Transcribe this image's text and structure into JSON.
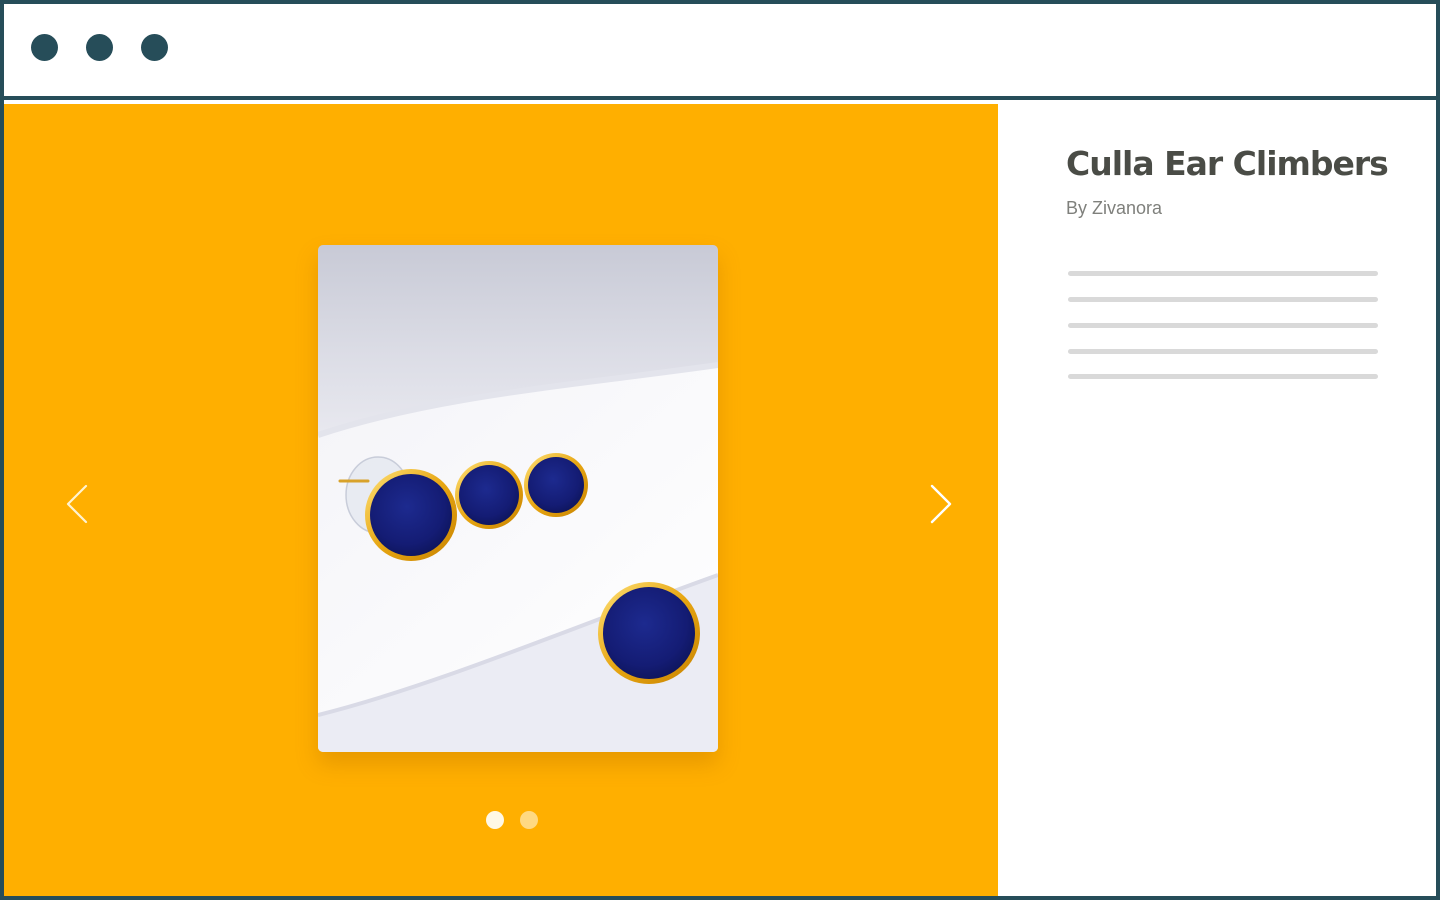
{
  "window": {
    "controls": [
      "window-dot",
      "window-dot",
      "window-dot"
    ],
    "frame_color": "#264d59"
  },
  "gallery": {
    "background_color": "#ffaf00",
    "prev_icon": "chevron-left-icon",
    "next_icon": "chevron-right-icon",
    "image_alt": "Navy enamel round earrings with gold rims on white fabric",
    "current_slide": 1,
    "slide_count": 2
  },
  "product": {
    "title": "Culla Ear Climbers",
    "brand": "By Zivanora",
    "description_placeholder_lines": 5
  }
}
